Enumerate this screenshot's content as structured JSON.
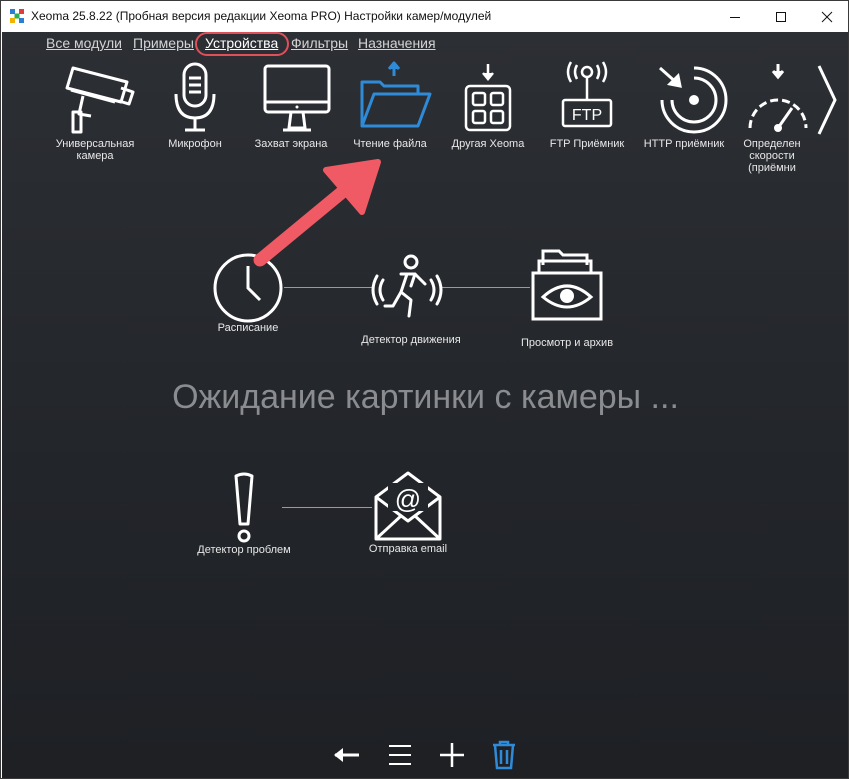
{
  "window": {
    "title": "Xeoma 25.8.22 (Пробная версия редакции Xeoma PRO) Настройки камер/модулей"
  },
  "tabs": [
    {
      "label": "Все модули"
    },
    {
      "label": "Примеры"
    },
    {
      "label": "Устройства",
      "active": true
    },
    {
      "label": "Фильтры"
    },
    {
      "label": "Назначения"
    }
  ],
  "devices": [
    {
      "label": "Универсальная камера",
      "icon": "cctv-camera-icon"
    },
    {
      "label": "Микрофон",
      "icon": "microphone-icon"
    },
    {
      "label": "Захват экрана",
      "icon": "monitor-icon"
    },
    {
      "label": "Чтение файла",
      "icon": "folder-upload-icon"
    },
    {
      "label": "Другая Xeoma",
      "icon": "grid-device-icon"
    },
    {
      "label": "FTP Приёмник",
      "icon": "ftp-receiver-icon",
      "icon_text": "FTP"
    },
    {
      "label": "HTTP приёмник",
      "icon": "http-receiver-icon"
    },
    {
      "label": "Определен скорости (приёмни",
      "icon": "speedometer-icon"
    }
  ],
  "chain1": [
    {
      "label": "Расписание",
      "icon": "clock-icon"
    },
    {
      "label": "Детектор движения",
      "icon": "running-man-icon"
    },
    {
      "label": "Просмотр и архив",
      "icon": "eye-archive-icon"
    }
  ],
  "chain2": [
    {
      "label": "Детектор проблем",
      "icon": "exclamation-icon"
    },
    {
      "label": "Отправка email",
      "icon": "envelope-at-icon",
      "icon_text": "@"
    }
  ],
  "waiting_text": "Ожидание картинки с камеры ...",
  "bottom_toolbar": [
    "back-arrow-icon",
    "menu-icon",
    "plus-icon",
    "trash-icon"
  ],
  "colors": {
    "accent_blue": "#2f8ad8",
    "highlight_red": "#e0505a",
    "arrow_red": "#f05a64"
  }
}
